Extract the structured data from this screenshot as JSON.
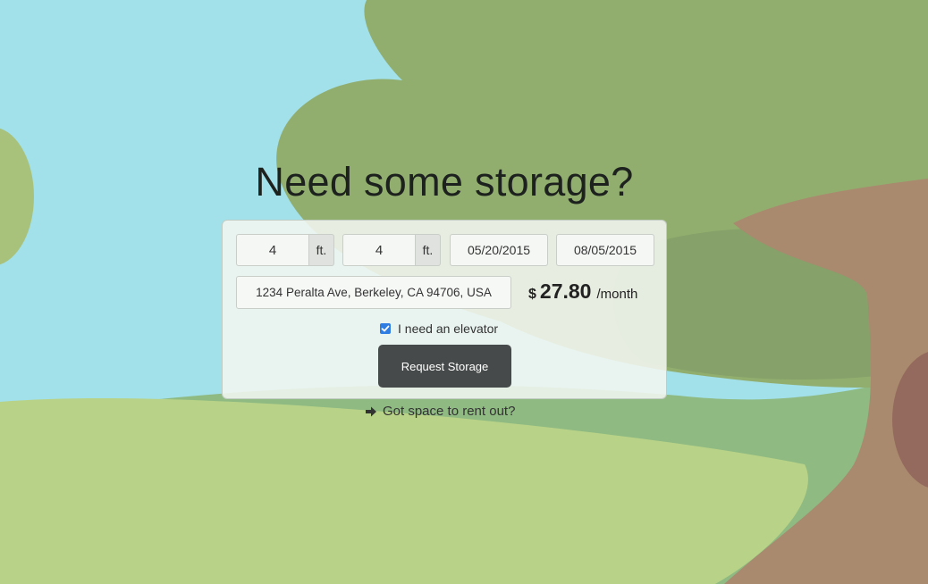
{
  "hero": {
    "title": "Need some storage?"
  },
  "form": {
    "width": {
      "value": "4",
      "unit": "ft."
    },
    "length": {
      "value": "4",
      "unit": "ft."
    },
    "start_date": "05/20/2015",
    "end_date": "08/05/2015",
    "address": "1234 Peralta Ave, Berkeley, CA 94706, USA",
    "price": {
      "currency": "$",
      "amount": "27.80",
      "period": "/month"
    },
    "elevator": {
      "label": "I need an elevator",
      "checked": true
    },
    "submit_label": "Request Storage"
  },
  "links": {
    "rent_out": "Got space to rent out?"
  },
  "colors": {
    "sky": "#a2e0ea",
    "tree_canopy": "#92ae6f",
    "tree_trunk": "#a98a6e",
    "grass_front": "#b8d388",
    "grass_back": "#8fba82",
    "button": "#474a4a",
    "checkbox": "#2f7ce3"
  },
  "icons": {
    "rent_out": "arrow-right-icon",
    "elevator_check": "checkmark-icon"
  }
}
